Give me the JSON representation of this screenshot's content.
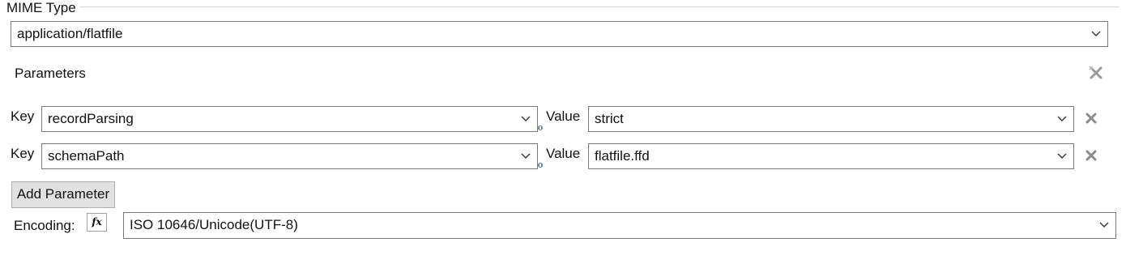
{
  "group": {
    "legend": "MIME Type"
  },
  "mime": {
    "value": "application/flatfile"
  },
  "parameters": {
    "title": "Parameters",
    "rows": [
      {
        "key_label": "Key",
        "key": "recordParsing",
        "value_label": "Value",
        "value": "strict"
      },
      {
        "key_label": "Key",
        "key": "schemaPath",
        "value_label": "Value",
        "value": "flatfile.ffd"
      }
    ],
    "add_button": "Add Parameter"
  },
  "encoding": {
    "label": "Encoding:",
    "fx": "fx",
    "value": "ISO 10646/Unicode(UTF-8)"
  },
  "icons": {
    "dropdown": "chevron-down-icon",
    "remove": "close-icon",
    "remove_all": "remove-all-icon",
    "info": "info-icon",
    "function": "function-icon"
  }
}
